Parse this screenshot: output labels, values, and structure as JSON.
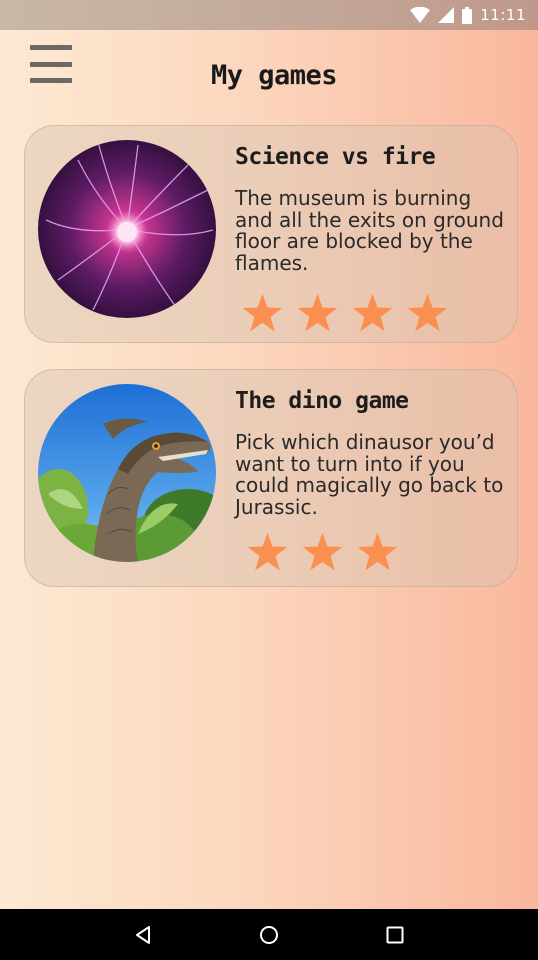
{
  "status_bar": {
    "time": "11:11",
    "icons": [
      "wifi-icon",
      "cell-signal-icon",
      "battery-icon"
    ]
  },
  "app_bar": {
    "title": "My games",
    "menu_icon": "hamburger-menu-icon"
  },
  "games": [
    {
      "title": "Science vs fire",
      "description": "The museum is burning and all the exits on ground floor are blocked by the flames.",
      "rating": 4,
      "image": "plasma-ball-image"
    },
    {
      "title": "The dino game",
      "description": "Pick which dinausor you’d want to turn into if you could magically go back to Jurassic.",
      "rating": 3,
      "image": "dinosaur-image"
    }
  ],
  "nav_bar": {
    "icons": [
      "back-icon",
      "home-icon",
      "recents-icon"
    ]
  },
  "colors": {
    "star": "#fb8f50",
    "background_start": "#fde9d2",
    "background_end": "#f9b79c",
    "title_text": "#1a1a1a"
  }
}
